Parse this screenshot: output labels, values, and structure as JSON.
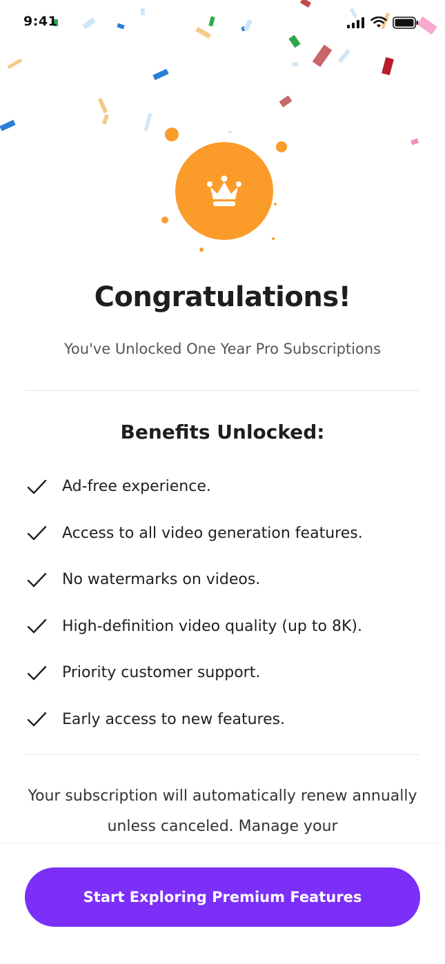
{
  "status_bar": {
    "time": "9:41",
    "icons": [
      "signal-icon",
      "wifi-icon",
      "battery-icon"
    ]
  },
  "hero": {
    "icon": "crown-icon",
    "badge_color": "#fb9b2a",
    "title": "Congratulations!",
    "subtitle": "You've Unlocked One Year Pro Subscriptions"
  },
  "benefits": {
    "title": "Benefits Unlocked:",
    "items": [
      "Ad-free experience.",
      "Access to all video generation features.",
      "No watermarks on videos.",
      "High-definition video quality (up to 8K).",
      "Priority customer support.",
      "Early access to new features."
    ]
  },
  "renewal_note": "Your subscription will automatically renew annually unless canceled. Manage your",
  "cta": {
    "label": "Start Exploring Premium Features",
    "color": "#7b2ff7"
  }
}
